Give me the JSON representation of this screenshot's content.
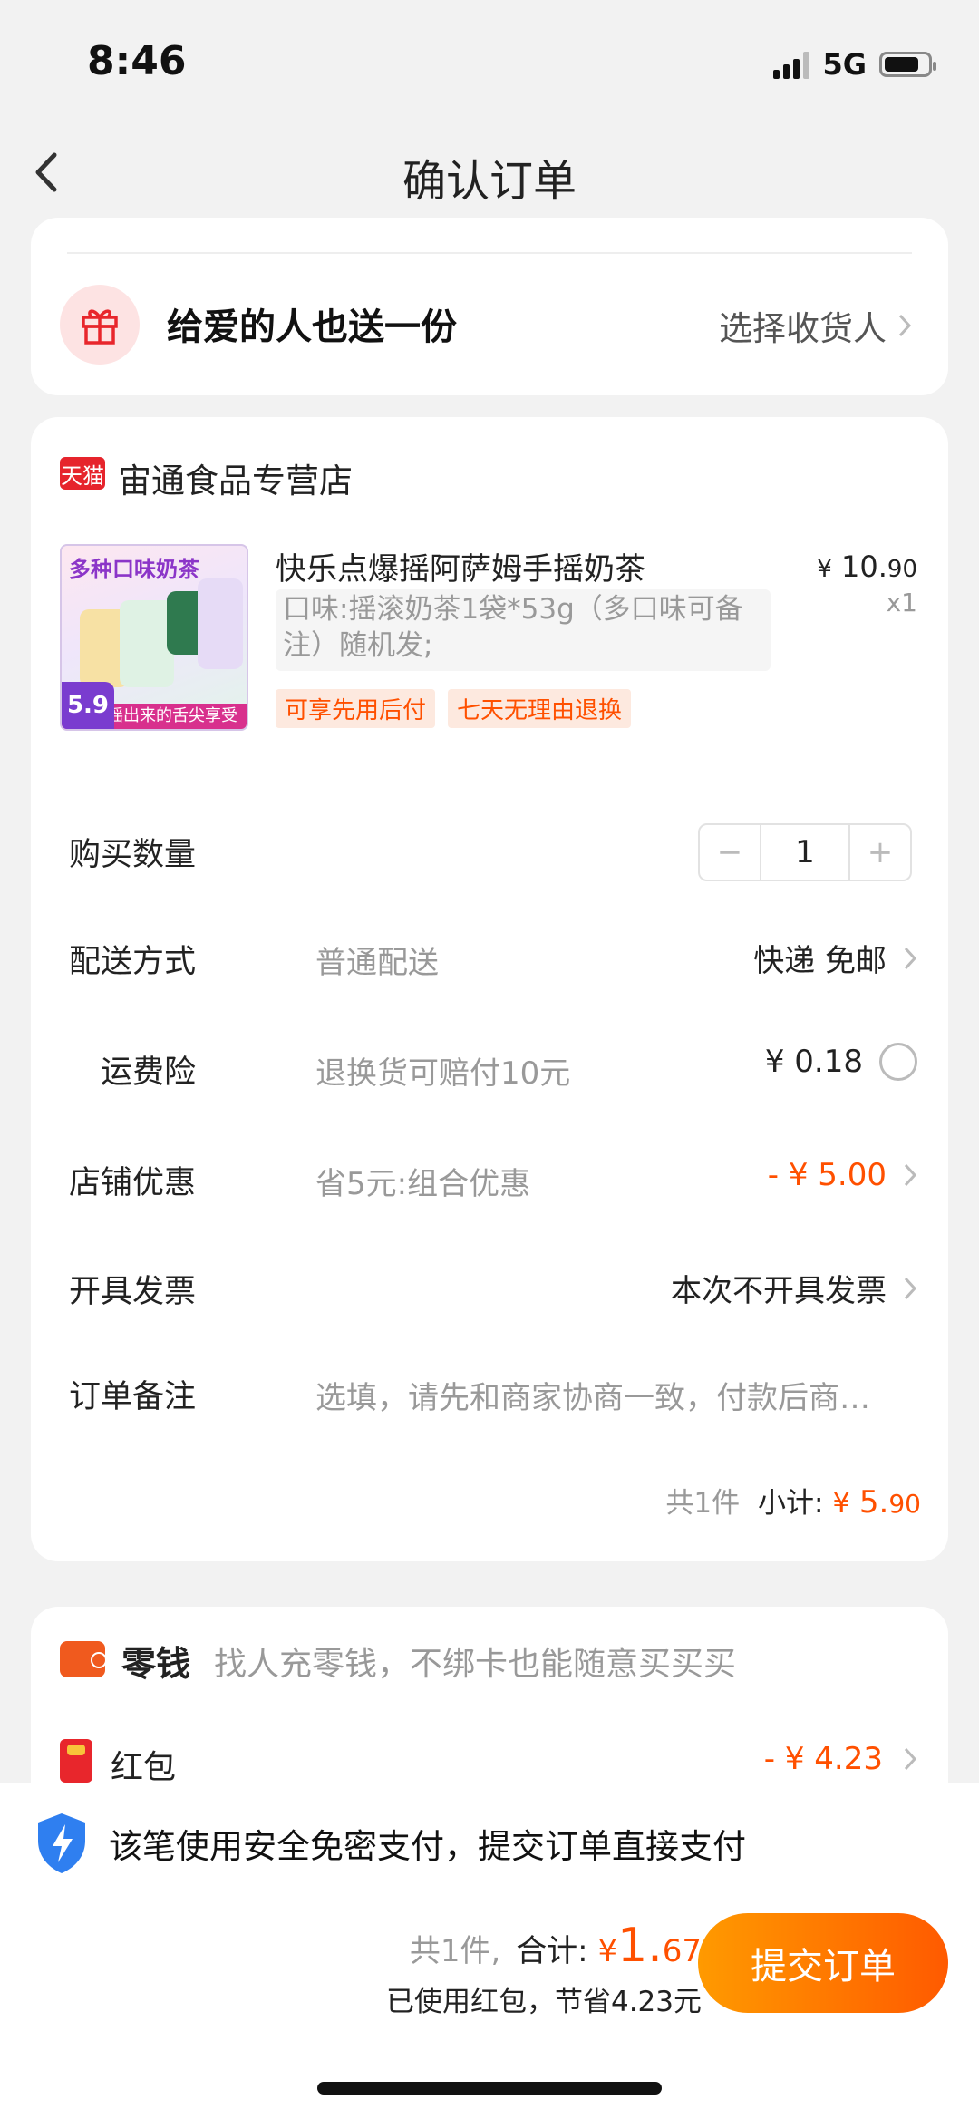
{
  "status": {
    "time": "8:46",
    "network": "5G",
    "battery_level": 0.8
  },
  "nav": {
    "title": "确认订单"
  },
  "gift": {
    "title": "给爱的人也送一份",
    "action": "选择收货人"
  },
  "store": {
    "badge": "天猫",
    "name": "宙通食品专营店",
    "product": {
      "image_headline": "多种口味奶茶",
      "image_price": "5.9",
      "image_slogan": "摇出来的舌尖享受",
      "title": "快乐点爆摇阿萨姆手摇奶茶",
      "spec": "口味:摇滚奶茶1袋*53g（多口味可备注）随机发;",
      "tags": [
        "可享先用后付",
        "七天无理由退换"
      ],
      "price_currency": "¥",
      "price_int": "10.",
      "price_dec": "90",
      "quantity_label": "x1"
    },
    "quantity": {
      "label": "购买数量",
      "value": "1",
      "minus": "−",
      "plus": "+"
    },
    "delivery": {
      "label": "配送方式",
      "sub": "普通配送",
      "value": "快递 免邮"
    },
    "insurance": {
      "label": "运费险",
      "sub": "退换货可赔付10元",
      "value": "¥ 0.18"
    },
    "discount": {
      "label": "店铺优惠",
      "sub": "省5元:组合优惠",
      "value": "- ¥ 5.00"
    },
    "invoice": {
      "label": "开具发票",
      "value": "本次不开具发票"
    },
    "note": {
      "label": "订单备注",
      "placeholder": "选填，请先和商家协商一致，付款后商…"
    },
    "subtotal": {
      "count": "共1件",
      "label": "小计:",
      "currency": "¥",
      "amount_int": "5.",
      "amount_dec": "90"
    }
  },
  "wallet": {
    "title": "零钱",
    "desc": "找人充零钱，不绑卡也能随意买买买",
    "redpack_label": "红包",
    "redpack_value": "- ¥ 4.23"
  },
  "footer": {
    "secure_text": "该笔使用安全免密支付，提交订单直接支付",
    "count": "共1件,",
    "total_label": "合计:",
    "currency": "¥",
    "total_int": "1.",
    "total_dec": "67",
    "saved": "已使用红包，节省4.23元",
    "submit": "提交订单"
  },
  "colors": {
    "accent": "#ff5000",
    "tmall_red": "#e6242c"
  }
}
